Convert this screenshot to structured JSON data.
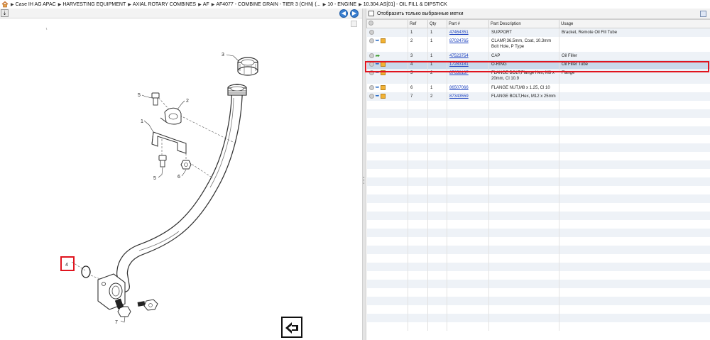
{
  "breadcrumb": [
    "Case IH AG APAC",
    "HARVESTING EQUIPMENT",
    "AXIAL ROTARY COMBINES",
    "AF",
    "AF4077 - COMBINE GRAIN - TIER 3 (CHN) (...",
    "10 - ENGINE",
    "10.304.AS[01] - OIL FILL & DIPSTICK"
  ],
  "icons": {
    "home": "home-icon",
    "nav_back": "back-arrow-icon",
    "nav_forward": "forward-arrow-icon"
  },
  "diagram": {
    "callouts": [
      "1",
      "2",
      "3",
      "4",
      "5",
      "5",
      "6",
      "7"
    ]
  },
  "right": {
    "filter_label": "Отобразить только выбранные метки",
    "columns": [
      "",
      "Ref",
      "Qty",
      "Part #",
      "Part Description",
      "Usage"
    ],
    "rows": [
      {
        "ref": "1",
        "qty": "1",
        "part": "47464351",
        "desc": "SUPPORT",
        "usage": "Bracket, Remote Oil Fill Tube",
        "icons": "circle"
      },
      {
        "ref": "2",
        "qty": "1",
        "part": "87024765",
        "desc": "CLAMP,36.5mm, Coat, 10.3mm Bolt Hole, P Type",
        "usage": "",
        "icons": "full"
      },
      {
        "ref": "3",
        "qty": "1",
        "part": "47523754",
        "desc": "CAP",
        "usage": "Oil Filler",
        "icons": "green"
      },
      {
        "ref": "4",
        "qty": "1",
        "part": "17283181",
        "desc": "O-RING",
        "usage": "Oil Filler Tube",
        "icons": "full"
      },
      {
        "ref": "5",
        "qty": "2",
        "part": "87658137",
        "desc": "FLANGE BOLT,Flange Hex, M8 x 20mm, Cl 10.9",
        "usage": "Flange",
        "icons": "full"
      },
      {
        "ref": "6",
        "qty": "1",
        "part": "86507066",
        "desc": "FLANGE NUT,M8 x 1.25, Cl 10",
        "usage": "",
        "icons": "full"
      },
      {
        "ref": "7",
        "qty": "2",
        "part": "87343559",
        "desc": "FLANGE BOLT,Hex, M12 x 25mm",
        "usage": "",
        "icons": "full"
      }
    ]
  },
  "colors": {
    "selected_row": "#c9d9ea",
    "highlight": "#e0141e",
    "link": "#1a3fbf"
  }
}
